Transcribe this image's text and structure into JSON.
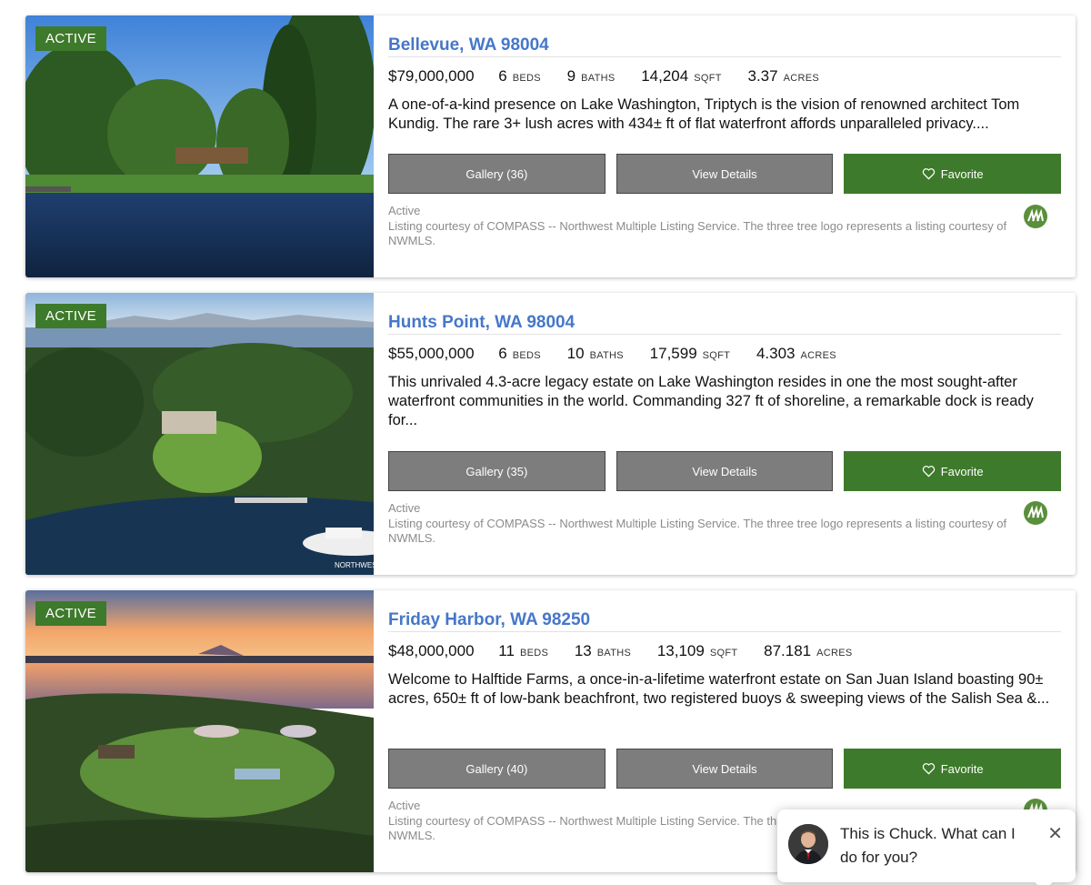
{
  "listings": [
    {
      "badge": "ACTIVE",
      "address": "Bellevue, WA 98004",
      "price": "$79,000,000",
      "beds": "6",
      "beds_unit": "BEDS",
      "baths": "9",
      "baths_unit": "BATHS",
      "sqft": "14,204",
      "sqft_unit": "SQFT",
      "acres": "3.37",
      "acres_unit": "ACRES",
      "description": "A one-of-a-kind presence on Lake Washington, Triptych is the vision of renowned architect Tom Kundig. The rare 3+ lush acres with 434± ft of flat waterfront affords unparalleled privacy....",
      "gallery_label": "Gallery  (36)",
      "details_label": "View Details",
      "favorite_label": "Favorite",
      "status": "Active",
      "courtesy": "Listing courtesy of COMPASS -- Northwest Multiple Listing Service. The three tree logo represents a listing courtesy of NWMLS."
    },
    {
      "badge": "ACTIVE",
      "address": "Hunts Point, WA 98004",
      "price": "$55,000,000",
      "beds": "6",
      "beds_unit": "BEDS",
      "baths": "10",
      "baths_unit": "BATHS",
      "sqft": "17,599",
      "sqft_unit": "SQFT",
      "acres": "4.303",
      "acres_unit": "ACRES",
      "description": "This unrivaled 4.3-acre legacy estate on Lake Washington resides in one the most sought-after waterfront communities in the world. Commanding 327 ft of shoreline, a remarkable dock is ready for...",
      "gallery_label": "Gallery  (35)",
      "details_label": "View Details",
      "favorite_label": "Favorite",
      "status": "Active",
      "courtesy": "Listing courtesy of COMPASS -- Northwest Multiple Listing Service. The three tree logo represents a listing courtesy of NWMLS.",
      "photo_watermark": "NORTHWES"
    },
    {
      "badge": "ACTIVE",
      "address": "Friday Harbor, WA 98250",
      "price": "$48,000,000",
      "beds": "11",
      "beds_unit": "BEDS",
      "baths": "13",
      "baths_unit": "BATHS",
      "sqft": "13,109",
      "sqft_unit": "SQFT",
      "acres": "87.181",
      "acres_unit": "ACRES",
      "description": "Welcome to Halftide Farms, a once-in-a-lifetime waterfront estate on San Juan Island boasting 90± acres, 650± ft of low-bank beachfront, two registered buoys & sweeping views of the Salish Sea &...",
      "gallery_label": "Gallery  (40)",
      "details_label": "View Details",
      "favorite_label": "Favorite",
      "status": "Active",
      "courtesy": "Listing courtesy of COMPASS -- Northwest Multiple Listing Service. The three tree logo represents a listing courtesy of NWMLS."
    }
  ],
  "chat": {
    "message": "This is Chuck. What can I do for you?",
    "close": "✕"
  },
  "colors": {
    "accent_green": "#3e7a2b",
    "link_blue": "#4677c9",
    "button_grey": "#7d7d7d"
  },
  "icons": [
    "heart-icon",
    "nwmls-three-tree-logo",
    "close-icon",
    "agent-avatar"
  ]
}
